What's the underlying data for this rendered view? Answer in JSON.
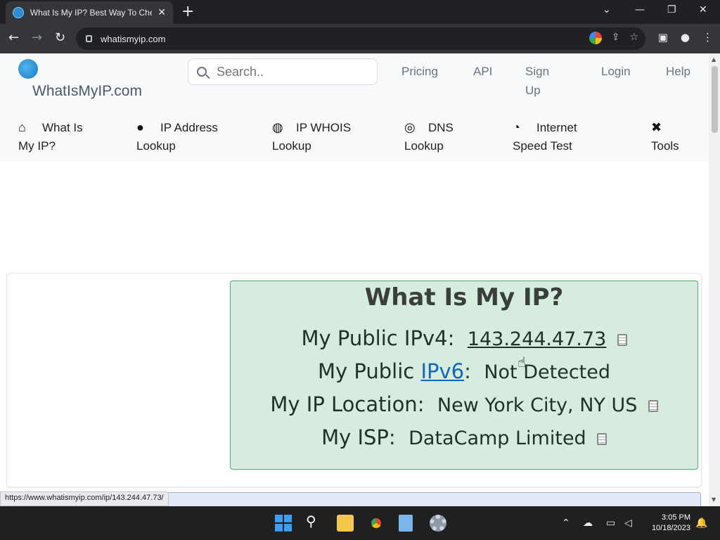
{
  "browser": {
    "tab_title": "What Is My IP? Best Way To Check",
    "url": "whatismyip.com",
    "status_url": "https://www.whatismyip.com/ip/143.244.47.73/"
  },
  "header": {
    "logo_text": "WhatIsMyIP.com",
    "search_placeholder": "Search..",
    "top_links": [
      "Pricing",
      "API",
      "Sign",
      "Up",
      "Login",
      "Help"
    ]
  },
  "mainnav": [
    {
      "line1": "What Is",
      "line2": "My IP?",
      "icon": "home-icon"
    },
    {
      "line1": "IP Address",
      "line2": "Lookup",
      "icon": "map-pin-icon"
    },
    {
      "line1": "IP WHOIS",
      "line2": "Lookup",
      "icon": "globe-icon"
    },
    {
      "line1": "DNS",
      "line2": "Lookup",
      "icon": "dns-globe-icon"
    },
    {
      "line1": "Internet",
      "line2": "Speed Test",
      "icon": "speedometer-icon"
    },
    {
      "line1": "Tools",
      "line2": "",
      "icon": "tools-icon"
    }
  ],
  "ipinfo": {
    "title": "What Is My IP?",
    "ipv4_label": "My Public IPv4:",
    "ipv4_value": "143.244.47.73",
    "ipv6_label_prefix": "My Public",
    "ipv6_link": "IPv6",
    "ipv6_colon": ":",
    "ipv6_value": "Not Detected",
    "location_label": "My IP Location:",
    "location_value": "New York City, NY US",
    "isp_label": "My ISP:",
    "isp_value": "DataCamp Limited"
  },
  "taskbar": {
    "time": "3:05 PM",
    "date": "10/18/2023"
  }
}
